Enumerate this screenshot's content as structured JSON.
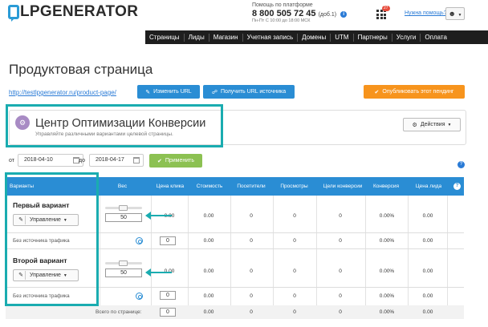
{
  "header": {
    "logo_text": "LPGENERATOR",
    "support_label": "Помощь по платформе",
    "phone": "8 800 505 72 45",
    "phone_ext": "(доб.1)",
    "hours": "Пн-Пт С 10:00 до 18:00 МСК",
    "notification_count": "27",
    "help_link": "Нужна помощь?"
  },
  "nav": [
    "Страницы",
    "Лиды",
    "Магазин",
    "Учетная запись",
    "Домены",
    "UTM",
    "Партнеры",
    "Услуги",
    "Оплата"
  ],
  "page": {
    "title": "Продуктовая страница",
    "url": "http://testlpgenerator.ru/product-page/",
    "change_url": "Изменить URL",
    "get_source_url": "Получить URL источника",
    "publish_pending": "Опубликовать этот пендинг"
  },
  "panel": {
    "title": "Центр Оптимизации Конверсии",
    "subtitle": "Управляйте различными вариантами целевой страницы.",
    "actions": "Действия"
  },
  "filter": {
    "from_label": "от",
    "from_date": "2018-04-10",
    "to_label": "до",
    "to_date": "2018-04-17",
    "apply": "Применить"
  },
  "table": {
    "headers": [
      "Варианты",
      "Вес",
      "Цена клика",
      "Стоимость",
      "Посетители",
      "Просмотры",
      "Цели конверсии",
      "Конверсия",
      "Цена лида"
    ],
    "variants": [
      {
        "name": "Первый вариант",
        "manage": "Управление",
        "weight": "50",
        "values": [
          "0.00",
          "0.00",
          "0",
          "0",
          "0",
          "0.00%",
          "0.00"
        ],
        "source_label": "Без источника трафика",
        "source_weight": "0",
        "source_values": [
          "0.00",
          "0.00",
          "0",
          "0",
          "0",
          "0.00%",
          "0.00"
        ]
      },
      {
        "name": "Второй вариант",
        "manage": "Управление",
        "weight": "50",
        "values": [
          "0.00",
          "0.00",
          "0",
          "0",
          "0",
          "0.00%",
          "0.00"
        ],
        "source_label": "Без источника трафика",
        "source_weight": "0",
        "source_values": [
          "0.00",
          "0.00",
          "0",
          "0",
          "0",
          "0.00%",
          "0.00"
        ]
      }
    ],
    "total_label": "Всего по странице:",
    "total_weight": "0",
    "totals": [
      "0.00",
      "0.00",
      "0",
      "0",
      "0",
      "0.00%",
      "0.00"
    ]
  },
  "colors": {
    "accent": "#2a8dd4",
    "highlight": "#1aacb0",
    "publish": "#f7941d",
    "apply": "#8cc152"
  }
}
